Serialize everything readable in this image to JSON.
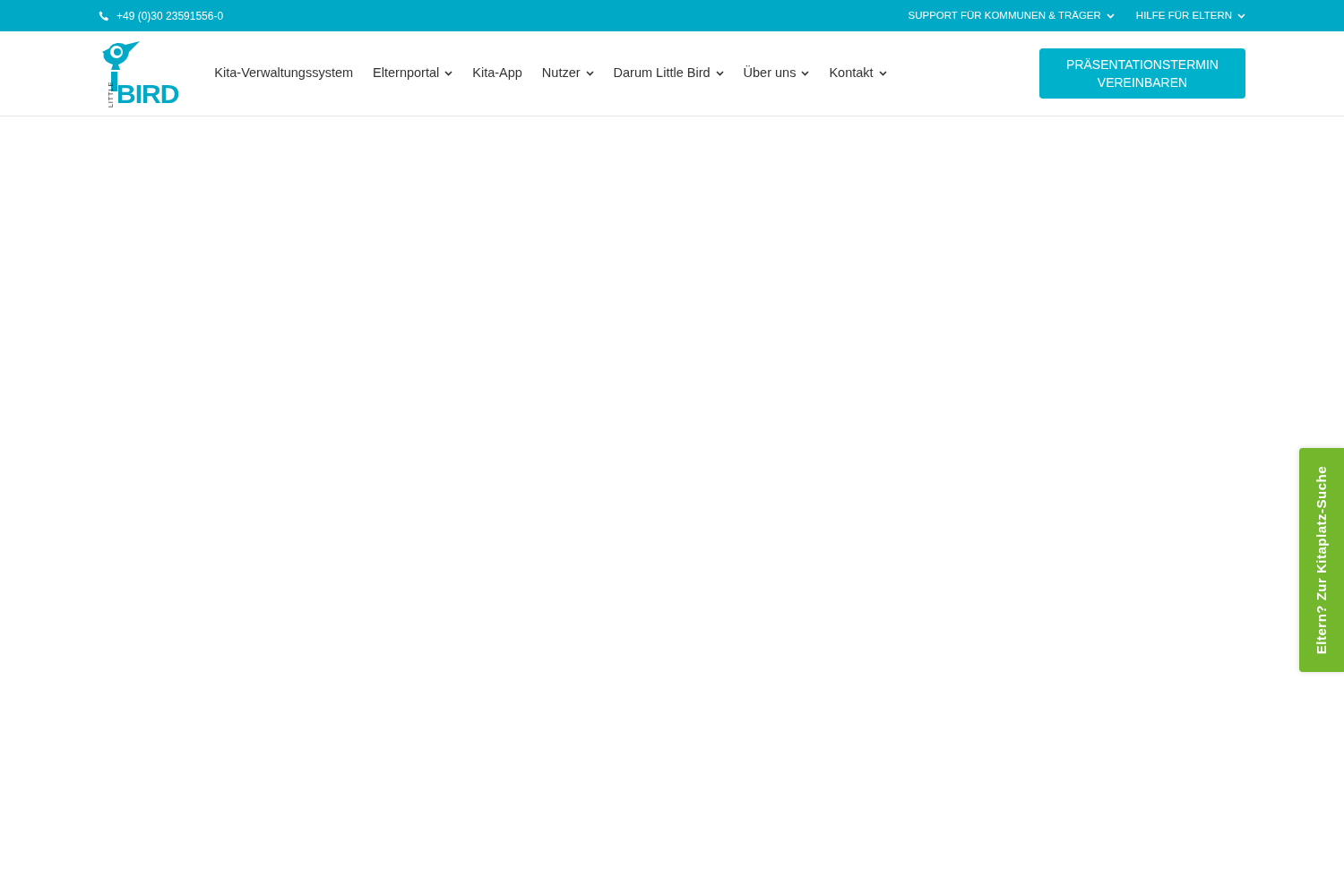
{
  "topbar": {
    "phone": "+49 (0)30 23591556-0",
    "links": [
      {
        "label": "SUPPORT FÜR KOMMUNEN & TRÄGER",
        "dropdown": true
      },
      {
        "label": "HILFE FÜR ELTERN",
        "dropdown": true
      }
    ]
  },
  "header": {
    "logo": {
      "small": "LITTLE",
      "big": "BIRD"
    },
    "nav": [
      {
        "label": "Kita-Verwaltungssystem",
        "dropdown": false
      },
      {
        "label": "Elternportal",
        "dropdown": true
      },
      {
        "label": "Kita-App",
        "dropdown": false
      },
      {
        "label": "Nutzer",
        "dropdown": true
      },
      {
        "label": "Darum Little Bird",
        "dropdown": true
      },
      {
        "label": "Über uns",
        "dropdown": true
      },
      {
        "label": "Kontakt",
        "dropdown": true
      }
    ],
    "cta": "PRÄSENTATIONSTERMIN VEREINBAREN"
  },
  "side_tab": "Eltern? Zur Kitaplatz-Suche"
}
